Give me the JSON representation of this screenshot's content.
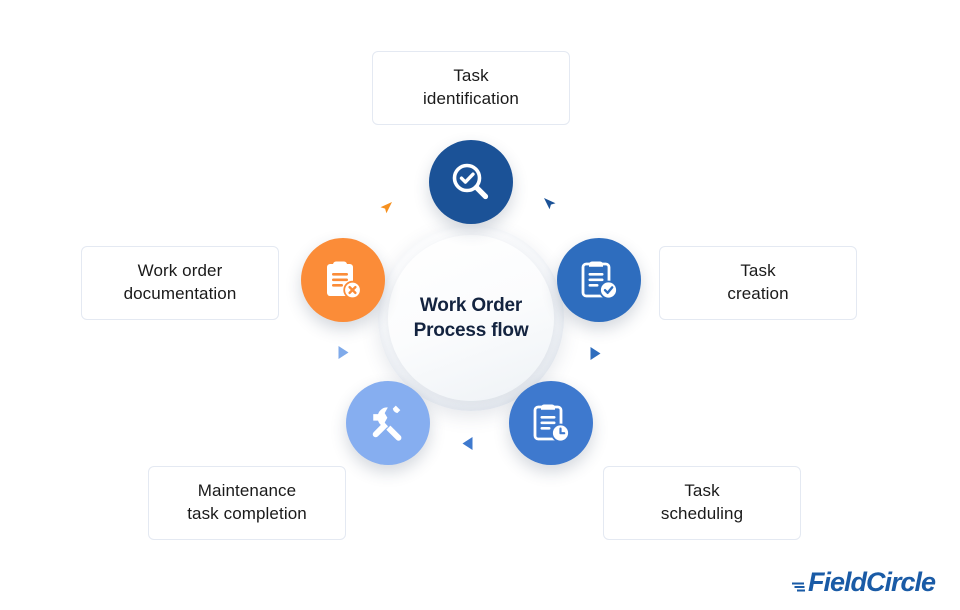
{
  "diagram": {
    "center": {
      "title": "Work Order\nProcess flow"
    },
    "nodes": [
      {
        "id": "task-identification",
        "label": "Task\nidentification",
        "icon": "magnifier-check-icon",
        "color": "#1B5297"
      },
      {
        "id": "task-creation",
        "label": "Task\ncreation",
        "icon": "clipboard-check-icon",
        "color": "#2E6DBE"
      },
      {
        "id": "task-scheduling",
        "label": "Task\nscheduling",
        "icon": "clipboard-clock-icon",
        "color": "#3E79CE"
      },
      {
        "id": "maintenance-task-completion",
        "label": "Maintenance\ntask completion",
        "icon": "wrench-screwdriver-icon",
        "color": "#86AEF0"
      },
      {
        "id": "work-order-documentation",
        "label": "Work order\ndocumentation",
        "icon": "clipboard-cross-icon",
        "color": "#FB8C38"
      }
    ],
    "markers": [
      {
        "id": "marker-top-left",
        "direction": "up-right",
        "color": "#F6901E"
      },
      {
        "id": "marker-top-right",
        "direction": "up-left",
        "color": "#1B5297"
      },
      {
        "id": "marker-bottom-left",
        "direction": "right",
        "color": "#7FAAEA"
      },
      {
        "id": "marker-bottom-right",
        "direction": "right",
        "color": "#2E6DBE"
      },
      {
        "id": "marker-bottom-center",
        "direction": "left",
        "color": "#3E79CE"
      }
    ]
  },
  "branding": {
    "name": "FieldCircle",
    "color": "#1a5ba6"
  }
}
